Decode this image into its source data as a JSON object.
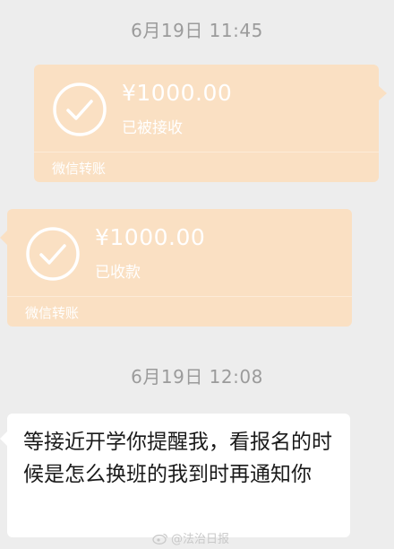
{
  "chat": {
    "timestamp_1": "6月19日 11:45",
    "timestamp_2": "6月19日 12:08",
    "transfer_sent": {
      "amount": "¥1000.00",
      "status": "已被接收",
      "footer": "微信转账"
    },
    "transfer_received": {
      "amount": "¥1000.00",
      "status": "已收款",
      "footer": "微信转账"
    },
    "message": {
      "text": "等接近开学你提醒我，看报名的时候是怎么换班的我到时再通知你"
    }
  },
  "watermark": {
    "text": "@法治日报",
    "icon": "weibo-icon"
  },
  "colors": {
    "background": "#ededed",
    "transfer_bubble": "#fae0c3",
    "text_bubble": "#ffffff",
    "timestamp": "#9b9b9b"
  }
}
